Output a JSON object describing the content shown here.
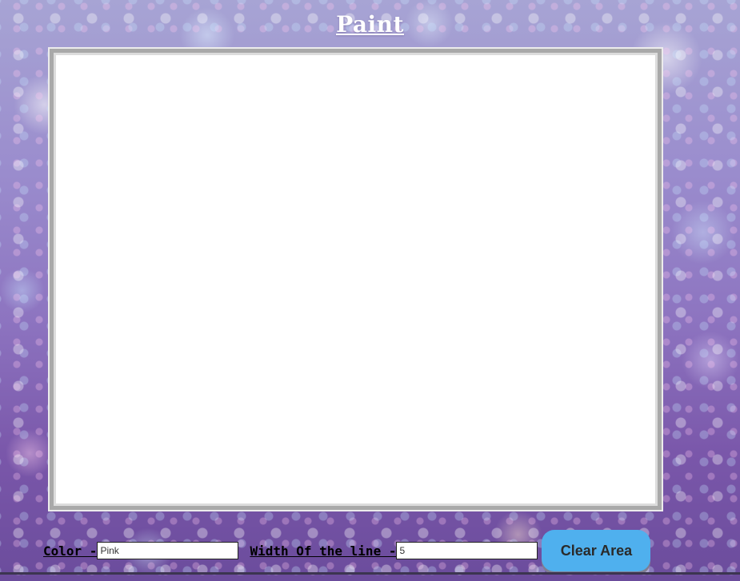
{
  "page": {
    "title": "Paint"
  },
  "toolbar": {
    "color_label": "Color - ",
    "color_value": "Pink",
    "width_label": "Width Of the line - ",
    "width_value": "5",
    "clear_label": "Clear Area"
  },
  "colors": {
    "button_bg": "#4fb0ee",
    "canvas_bg": "#ffffff",
    "canvas_border": "#a9a9a9",
    "title_text": "#ffffff"
  }
}
